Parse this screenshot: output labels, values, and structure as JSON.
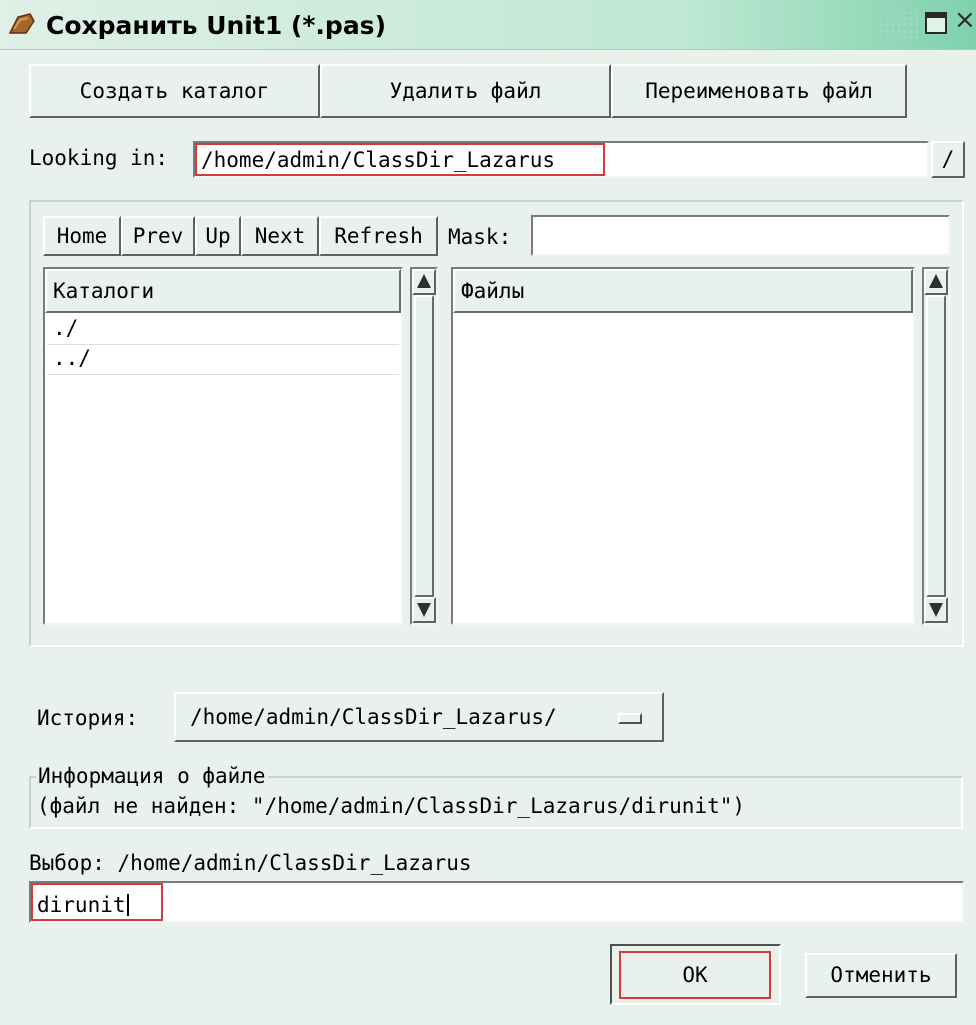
{
  "window": {
    "title": "Сохранить Unit1 (*.pas)",
    "icons": {
      "app": "folder-brush-icon",
      "maximize": "maximize-icon",
      "close": "close-icon"
    }
  },
  "toolbar": {
    "create_dir": "Создать каталог",
    "delete_file": "Удалить файл",
    "rename_file": "Переименовать файл"
  },
  "looking_in": {
    "label": "Looking in:",
    "value": "/home/admin/ClassDir_Lazarus",
    "browse_label": "/"
  },
  "nav": {
    "home": "Home",
    "prev": "Prev",
    "up": "Up",
    "next": "Next",
    "refresh": "Refresh",
    "mask_label": "Mask:",
    "mask_value": ""
  },
  "dirs": {
    "header": "Каталоги",
    "items": [
      "./",
      "../"
    ]
  },
  "files": {
    "header": "Файлы",
    "items": []
  },
  "history": {
    "label": "История:",
    "value": "/home/admin/ClassDir_Lazarus/"
  },
  "file_info": {
    "legend": "Информация о файле",
    "text": "(файл не найден: \"/home/admin/ClassDir_Lazarus/dirunit\")"
  },
  "selection": {
    "label": "Выбор: /home/admin/ClassDir_Lazarus",
    "value": "dirunit"
  },
  "buttons": {
    "ok": "OK",
    "cancel": "Отменить"
  }
}
